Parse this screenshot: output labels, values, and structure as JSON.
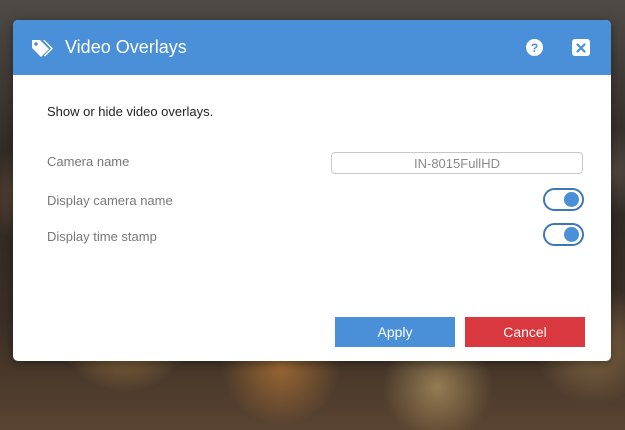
{
  "dialog": {
    "title": "Video Overlays",
    "title_icon": "tags-icon",
    "help_label": "?",
    "close_icon": "close-icon",
    "description": "Show or hide video overlays."
  },
  "fields": {
    "camera_name_label": "Camera name",
    "camera_name_value": "IN-8015FullHD",
    "display_camera_name_label": "Display camera name",
    "display_camera_name_on": true,
    "display_time_stamp_label": "Display time stamp",
    "display_time_stamp_on": true
  },
  "buttons": {
    "apply_label": "Apply",
    "cancel_label": "Cancel"
  },
  "colors": {
    "header": "#4a90d9",
    "apply": "#4a90d9",
    "cancel": "#d9383f"
  }
}
